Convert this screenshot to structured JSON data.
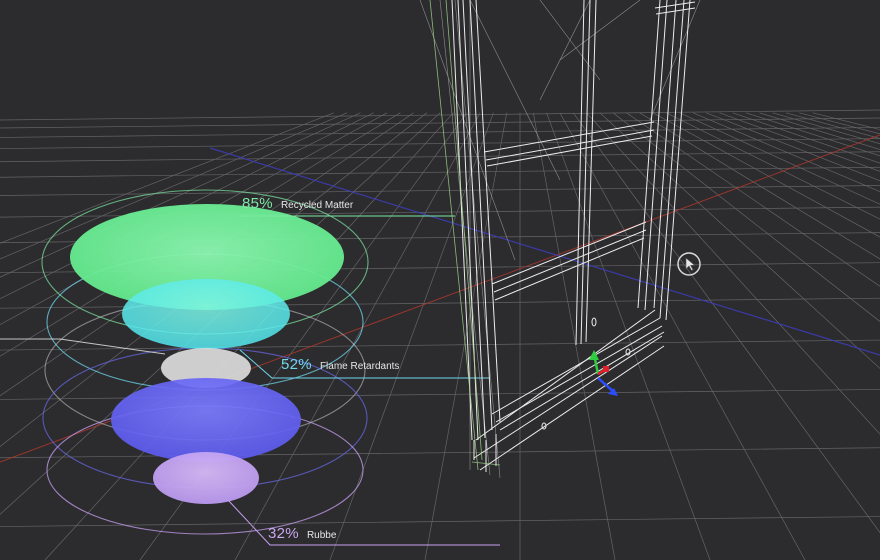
{
  "viewport": {
    "background": "#2c2c2e",
    "grid_color": "#7a7a7d",
    "axis_x_color": "#c0392b",
    "axis_z_color": "#3a3ab8"
  },
  "model": {
    "name": "window-frame-wireframe",
    "color": "#e9e9e9",
    "guide_color": "#9fd48a"
  },
  "gizmo": {
    "y_color": "#2ecc40",
    "x_color": "#e0202a",
    "z_color": "#2a4dff"
  },
  "chart_data": {
    "type": "stacked-ellipse-infographic",
    "series": [
      {
        "label": "Recycled Matter",
        "value": 85,
        "value_text": "85%",
        "color": "#72f29a"
      },
      {
        "label": "Flame Retardants",
        "value": 52,
        "value_text": "52%",
        "color": "#6ff0e8"
      },
      {
        "label": "",
        "value": null,
        "value_text": "",
        "color": "#dcdcdc"
      },
      {
        "label": "",
        "value": null,
        "value_text": "",
        "color": "#6160f5"
      },
      {
        "label": "Rubbe",
        "value": 32,
        "value_text": "32%",
        "color": "#c7a0f2"
      }
    ]
  },
  "callouts": [
    {
      "pct": "85%",
      "label": "Recycled Matter"
    },
    {
      "pct": "52%",
      "label": "Flame Retardants"
    },
    {
      "pct": "32%",
      "label": "Rubbe"
    }
  ],
  "cursor": {
    "icon": "select-cursor-icon"
  }
}
